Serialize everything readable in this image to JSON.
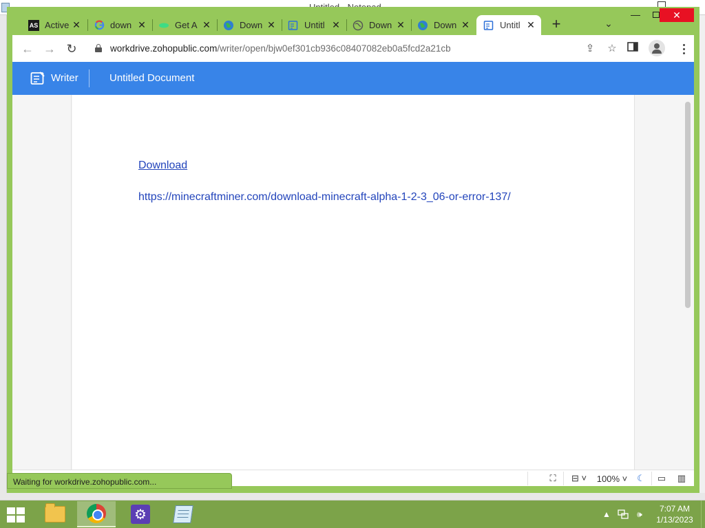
{
  "background_window": {
    "title": "Untitled - Notepad"
  },
  "browser": {
    "tabs": [
      {
        "label": "Active",
        "icon": "as-icon",
        "active": false
      },
      {
        "label": "down",
        "icon": "google-icon",
        "active": false
      },
      {
        "label": "Get A",
        "icon": "link-icon",
        "active": false
      },
      {
        "label": "Down",
        "icon": "globe-icon",
        "active": false
      },
      {
        "label": "Untitl",
        "icon": "writer-icon",
        "active": false
      },
      {
        "label": "Down",
        "icon": "globe-icon",
        "active": false
      },
      {
        "label": "Down",
        "icon": "globe-icon",
        "active": false
      },
      {
        "label": "Untitl",
        "icon": "writer-icon",
        "active": true
      }
    ],
    "new_tab_symbol": "+",
    "tab_close_symbol": "✕",
    "url_host": "workdrive.zohopublic.com",
    "url_path": "/writer/open/bjw0ef301cb936c08407082eb0a5fcd2a21cb"
  },
  "writer": {
    "app_name": "Writer",
    "doc_title": "Untitled Document",
    "link_text": "Download ",
    "url_text": "https://minecraftminer.com/download-minecraft-alpha-1-2-3_06-or-error-137/"
  },
  "status": {
    "loading_text": "Waiting for workdrive.zohopublic.com...",
    "zoom": "100%"
  },
  "taskbar": {
    "time": "7:07 AM",
    "date": "1/13/2023"
  },
  "colors": {
    "chrome_frame": "#96c85a",
    "writer_header": "#3884e8",
    "link": "#2244bb",
    "taskbar": "#7ca349"
  }
}
